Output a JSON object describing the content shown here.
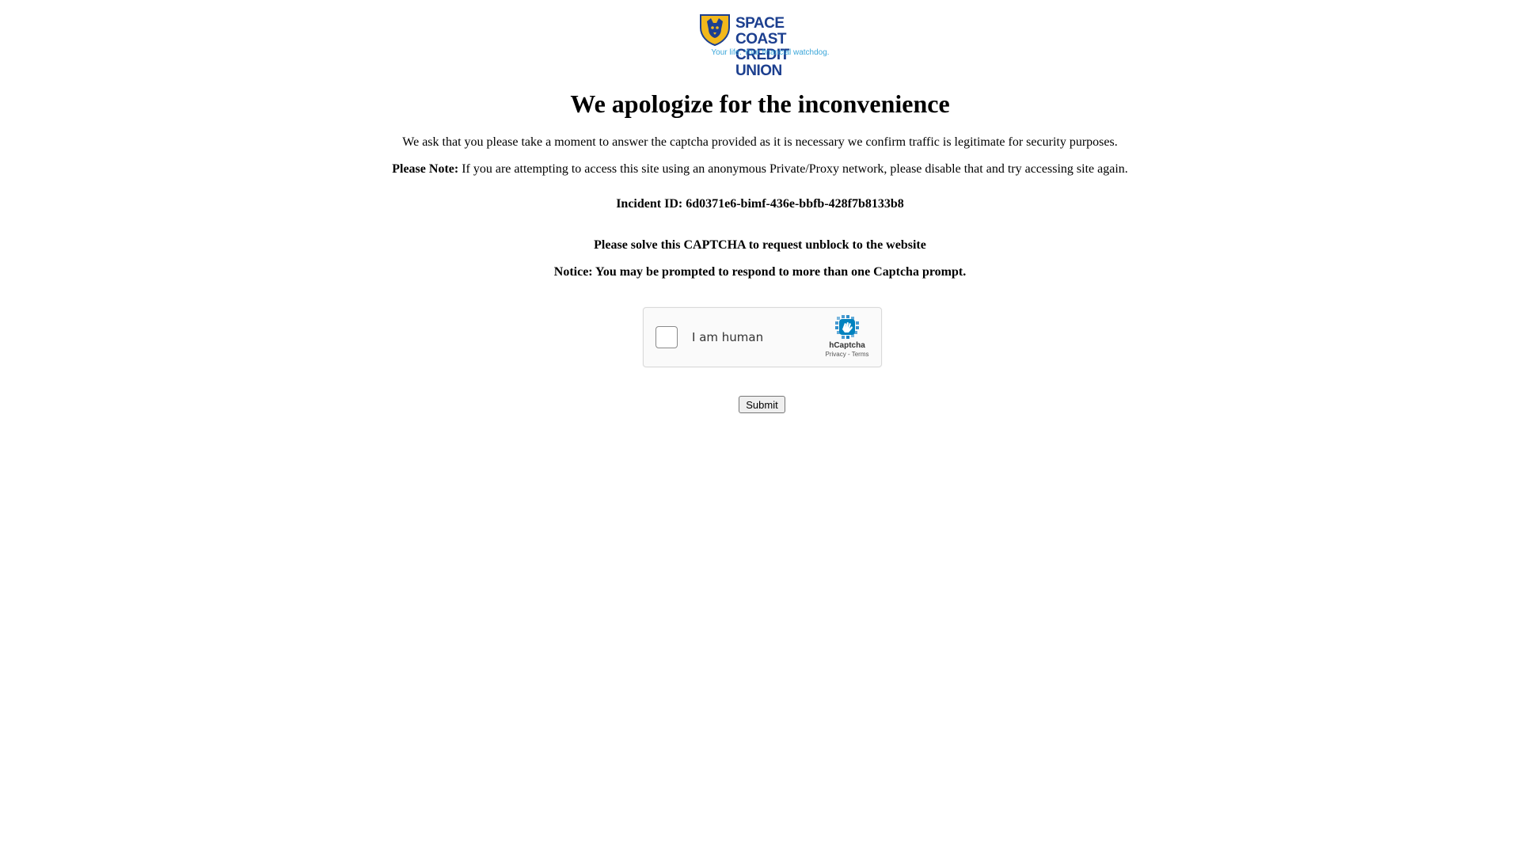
{
  "logo": {
    "line1": "SPACE COAST",
    "line2": "CREDIT UNION",
    "tagline": "Your life. Your financial watchdog.",
    "brand_color": "#1c3f8f",
    "accent_color": "#f2b81b",
    "tagline_color": "#3aa6d9",
    "icon": "watchdog-shield-icon"
  },
  "title": "We apologize for the inconvenience",
  "intro": "We ask that you please take a moment to answer the captcha provided as it is necessary we confirm traffic is legitimate for security purposes.",
  "note": {
    "label": "Please Note:",
    "text": " If you are attempting to access this site using an anonymous Private/Proxy network, please disable that and try accessing site again."
  },
  "incident": "Incident ID: 6d0371e6-bimf-436e-bbfb-428f7b8133b8",
  "solve_prompt": "Please solve this CAPTCHA to request unblock to the website",
  "notice": "Notice: You may be prompted to respond to more than one Captcha prompt.",
  "captcha": {
    "label": "I am human",
    "brand": "hCaptcha",
    "privacy": "Privacy",
    "separator": " - ",
    "terms": "Terms",
    "checked": false,
    "logo_color": "#0074bf",
    "icon": "hcaptcha-hand-icon"
  },
  "submit_label": "Submit"
}
